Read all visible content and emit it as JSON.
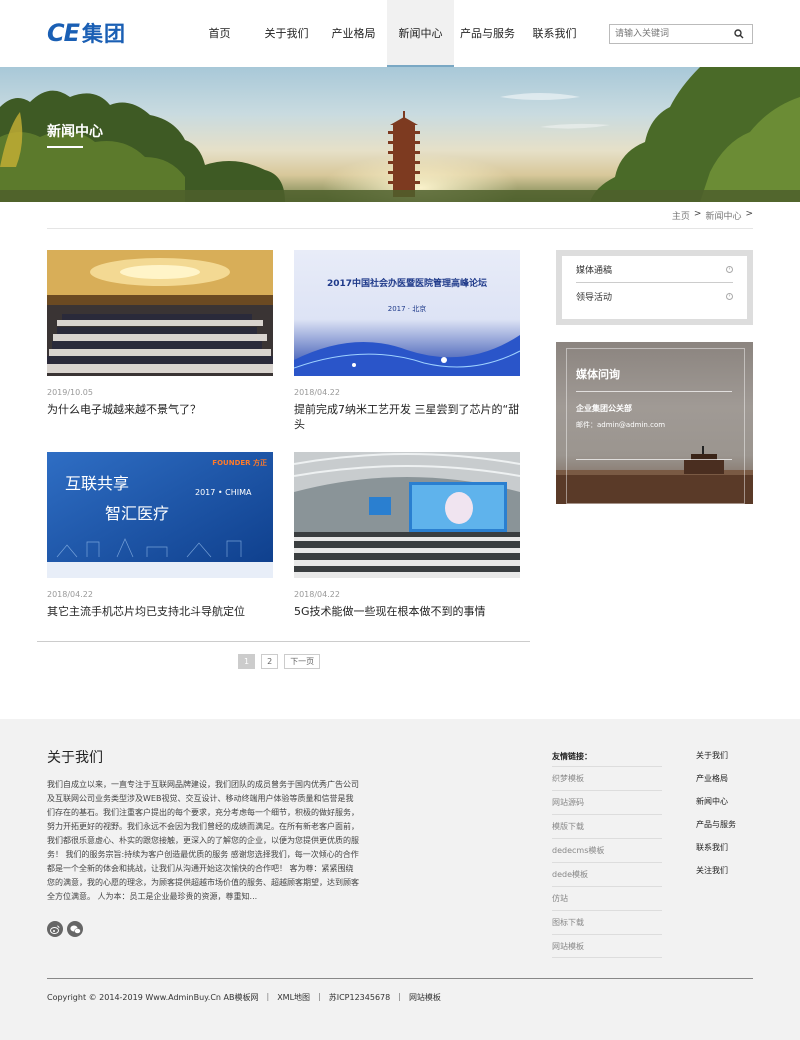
{
  "header": {
    "logo_latin": "CE",
    "logo_cn": "集团",
    "nav": [
      "首页",
      "关于我们",
      "产业格局",
      "新闻中心",
      "产品与服务",
      "联系我们"
    ],
    "active_nav": "新闻中心",
    "search_placeholder": "请输入关键词"
  },
  "banner": {
    "title": "新闻中心"
  },
  "breadcrumb": {
    "home": "主页",
    "sep": ">",
    "current": "新闻中心",
    "end": ">"
  },
  "news": [
    {
      "date": "2019/10.05",
      "title": "为什么电子城越来越不景气了？"
    },
    {
      "date": "2018/04.22",
      "title": "提前完成7纳米工艺开发 三星尝到了芯片的“甜头",
      "image_text": "2017中国社会办医暨医院管理高峰论坛",
      "image_sub": "2017 · 北京"
    },
    {
      "date": "2018/04.22",
      "title": "其它主流手机芯片均已支持北斗导航定位",
      "image_text_1": "互联共享",
      "image_text_2": "智汇医疗",
      "image_brand": "FOUNDER 方正",
      "image_event": "2017 • CHIMA"
    },
    {
      "date": "2018/04.22",
      "title": "5G技术能做一些现在根本做不到的事情"
    }
  ],
  "pagination": {
    "pages": [
      "1",
      "2"
    ],
    "next": "下一页",
    "current": "1"
  },
  "sidebar": {
    "menu": [
      "媒体通稿",
      "领导活动"
    ],
    "contact": {
      "title": "媒体问询",
      "company": "企业集团公关部",
      "email": "邮件：admin@admin.com"
    }
  },
  "footer": {
    "about_title": "关于我们",
    "about_text": "我们自成立以来，一直专注于互联网品牌建设，我们团队的成员曾务于国内优秀广告公司及互联网公司业务类型涉及WEB视觉、交互设计、移动终端用户体验等质量和信誉是我们存在的基石。我们注重客户提出的每个要求，充分考虑每一个细节，积极的做好服务，努力开拓更好的视野。我们永远不会因为我们曾经的成绩而满足。在所有新老客户面前，我们都很乐意虚心、朴实的跟您接触，更深入的了解您的企业，以便为您提供更优质的服务！ 我们的服务宗旨:持续为客户创造最优质的服务 感谢您选择我们，每一次倾心的合作都是一个全新的体会和挑战，让我们从沟通开始这次愉快的合作吧！ 客为尊：紧紧围绕您的满意，我的心愿的理念，为顾客提供超越市场价值的服务、超越顾客期望，达到顾客全方位满意。 人为本：员工是企业最珍贵的资源，尊重知...",
    "links_title": "友情链接：",
    "links": [
      "织梦模板",
      "网站源码",
      "模版下载",
      "dedecms模板",
      "dede模板",
      "仿站",
      "图标下载",
      "网站模板"
    ],
    "nav": [
      "关于我们",
      "产业格局",
      "新闻中心",
      "产品与服务",
      "联系我们",
      "关注我们"
    ],
    "copyright": "Copyright © 2014-2019 Www.AdminBuy.Cn AB模板网",
    "bottom_links": [
      "XML地图",
      "苏ICP12345678",
      "网站模板"
    ]
  }
}
